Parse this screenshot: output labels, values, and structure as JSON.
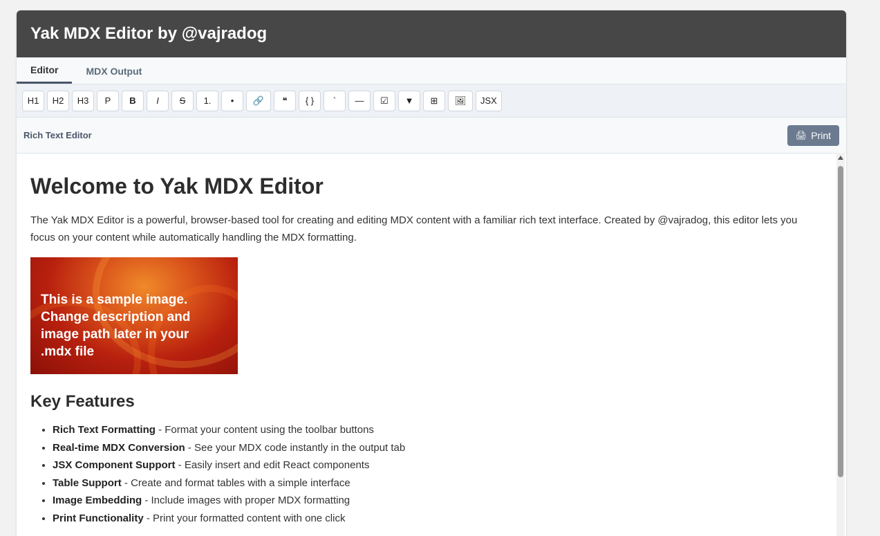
{
  "app": {
    "title": "Yak MDX Editor by @vajradog"
  },
  "tabs": [
    {
      "label": "Editor"
    },
    {
      "label": "MDX Output"
    }
  ],
  "toolbar": {
    "buttons": [
      "H1",
      "H2",
      "H3",
      "P",
      "B",
      "I",
      "S",
      "1.",
      "•",
      "🔗",
      "❝",
      "{ }",
      "`",
      "—",
      "☑",
      "▼",
      "⊞",
      "🖼",
      "JSX"
    ]
  },
  "status": {
    "label": "Rich Text Editor",
    "print_label": "Print",
    "print_icon": "🖨"
  },
  "document": {
    "title": "Welcome to Yak MDX Editor",
    "intro": "The Yak MDX Editor is a powerful, browser-based tool for creating and editing MDX content with a familiar rich text interface. Created by @vajradog, this editor lets you focus on your content while automatically handling the MDX formatting.",
    "image_text": "This is a sample image. Change description and image path later in your .mdx file",
    "features_title": "Key Features",
    "features": [
      {
        "name": "Rich Text Formatting",
        "desc": " - Format your content using the toolbar buttons"
      },
      {
        "name": "Real-time MDX Conversion",
        "desc": " - See your MDX code instantly in the output tab"
      },
      {
        "name": "JSX Component Support",
        "desc": " - Easily insert and edit React components"
      },
      {
        "name": "Table Support",
        "desc": " - Create and format tables with a simple interface"
      },
      {
        "name": "Image Embedding",
        "desc": " - Include images with proper MDX formatting"
      },
      {
        "name": "Print Functionality",
        "desc": " - Print your formatted content with one click"
      }
    ]
  },
  "colors": {
    "header_bg": "#474747",
    "print_button_bg": "#6b7a8f"
  }
}
